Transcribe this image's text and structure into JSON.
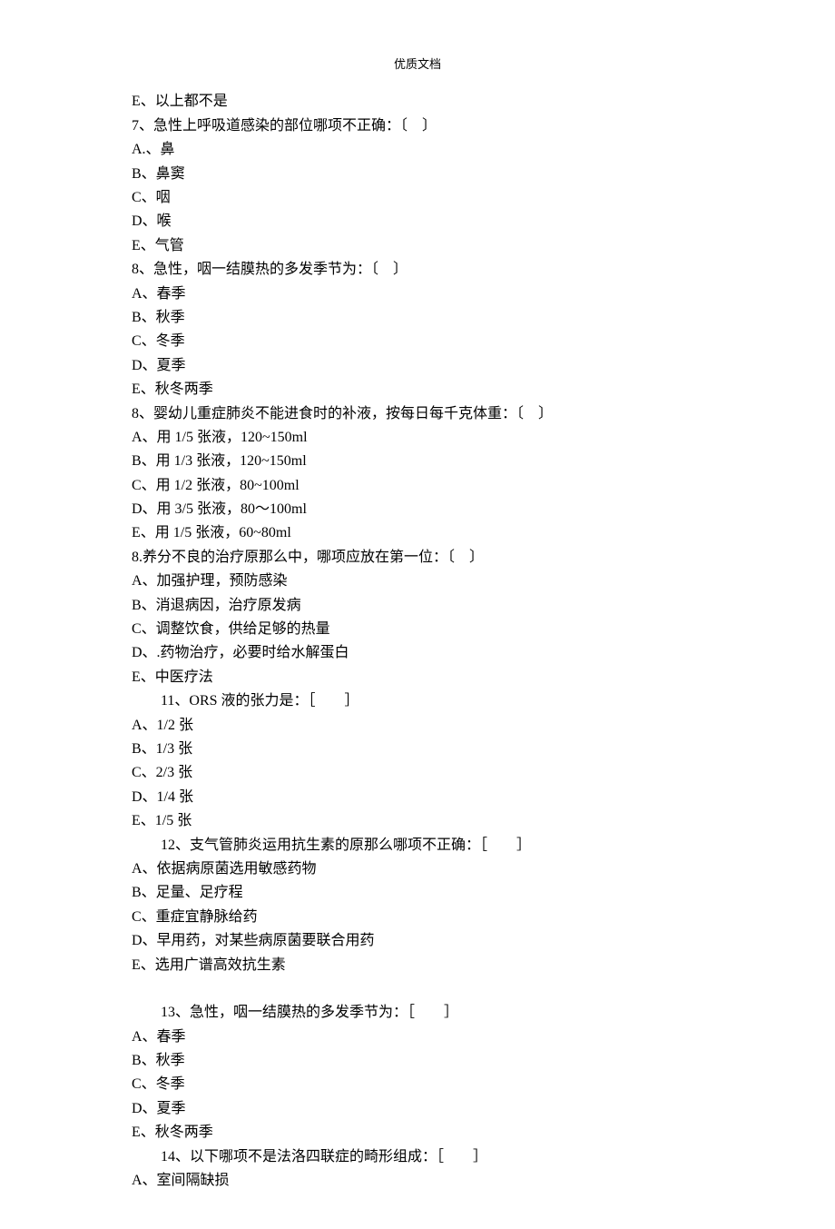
{
  "header": "优质文档",
  "lines": [
    {
      "text": "E、以上都不是",
      "indent": false
    },
    {
      "text": "7、急性上呼吸道感染的部位哪项不正确：〔　〕",
      "indent": false
    },
    {
      "text": "A.、鼻",
      "indent": false
    },
    {
      "text": "B、鼻窦",
      "indent": false
    },
    {
      "text": "C、咽",
      "indent": false
    },
    {
      "text": "D、喉",
      "indent": false
    },
    {
      "text": "E、气管",
      "indent": false
    },
    {
      "text": "8、急性，咽一结膜热的多发季节为：〔　〕",
      "indent": false
    },
    {
      "text": "A、春季",
      "indent": false
    },
    {
      "text": "B、秋季",
      "indent": false
    },
    {
      "text": "C、冬季",
      "indent": false
    },
    {
      "text": "D、夏季",
      "indent": false
    },
    {
      "text": "E、秋冬两季",
      "indent": false
    },
    {
      "text": "8、婴幼儿重症肺炎不能进食时的补液，按每日每千克体重：〔　〕",
      "indent": false
    },
    {
      "text": "A、用 1/5 张液，120~150ml",
      "indent": false
    },
    {
      "text": "B、用 1/3 张液，120~150ml",
      "indent": false
    },
    {
      "text": "C、用 1/2 张液，80~100ml",
      "indent": false
    },
    {
      "text": "D、用 3/5 张液，80～100ml",
      "indent": false
    },
    {
      "text": "E、用 1/5 张液，60~80ml",
      "indent": false
    },
    {
      "text": "8.养分不良的治疗原那么中，哪项应放在第一位：〔　〕",
      "indent": false
    },
    {
      "text": "A、加强护理，预防感染",
      "indent": false
    },
    {
      "text": "B、消退病因，治疗原发病",
      "indent": false
    },
    {
      "text": "C、调整饮食，供给足够的热量",
      "indent": false
    },
    {
      "text": "D、.药物治疗，必要时给水解蛋白",
      "indent": false
    },
    {
      "text": "E、中医疗法",
      "indent": false
    },
    {
      "text": "11、ORS 液的张力是：［　　］",
      "indent": true
    },
    {
      "text": "A、1/2 张",
      "indent": false
    },
    {
      "text": "B、1/3 张",
      "indent": false
    },
    {
      "text": "C、2/3 张",
      "indent": false
    },
    {
      "text": "D、1/4 张",
      "indent": false
    },
    {
      "text": "E、1/5 张",
      "indent": false
    },
    {
      "text": "12、支气管肺炎运用抗生素的原那么哪项不正确：［　　］",
      "indent": true
    },
    {
      "text": "A、依据病原菌选用敏感药物",
      "indent": false
    },
    {
      "text": "B、足量、足疗程",
      "indent": false
    },
    {
      "text": "C、重症宜静脉给药",
      "indent": false
    },
    {
      "text": "D、早用药，对某些病原菌要联合用药",
      "indent": false
    },
    {
      "text": "E、选用广谱高效抗生素",
      "indent": false
    },
    {
      "text": "",
      "indent": false
    },
    {
      "text": "13、急性，咽一结膜热的多发季节为：［　　］",
      "indent": true
    },
    {
      "text": "A、春季",
      "indent": false
    },
    {
      "text": "B、秋季",
      "indent": false
    },
    {
      "text": "C、冬季",
      "indent": false
    },
    {
      "text": "D、夏季",
      "indent": false
    },
    {
      "text": "E、秋冬两季",
      "indent": false
    },
    {
      "text": "14、以下哪项不是法洛四联症的畸形组成：［　　］",
      "indent": true
    },
    {
      "text": "A、室间隔缺损",
      "indent": false
    }
  ]
}
